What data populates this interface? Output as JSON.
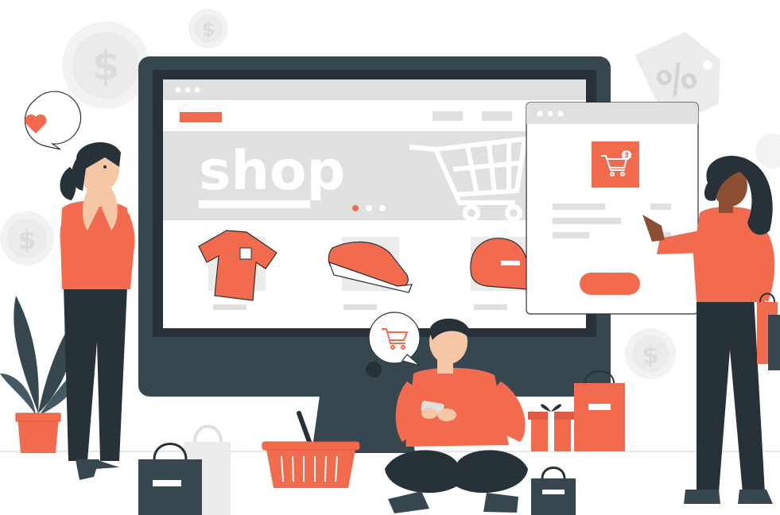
{
  "scene": {
    "description_free": true,
    "colors": {
      "accent": "#f26b4e",
      "dark": "#263238",
      "monitor": "#37474f",
      "screen": "#e0e0e0",
      "light_gray": "#ebebeb",
      "skin_light": "#f6c7a6",
      "skin_dark": "#8d4f33",
      "white": "#ffffff"
    }
  },
  "screen": {
    "banner_word": "shop",
    "carousel_dots": 3,
    "products": [
      "tshirt-icon",
      "sneaker-icon",
      "cap-icon"
    ]
  },
  "popup": {
    "cart_badge": "3"
  },
  "icons": [
    "heart-icon",
    "dollar-coin-icon",
    "percent-tag-icon",
    "cart-icon",
    "shopping-bag-icon",
    "gift-box-icon",
    "plant-icon",
    "basket-icon"
  ]
}
